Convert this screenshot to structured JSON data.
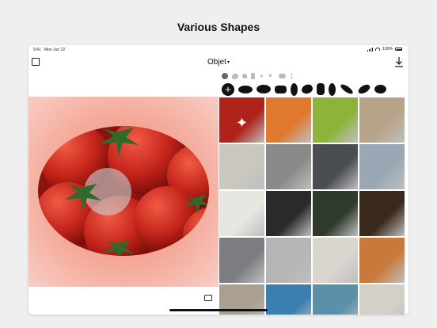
{
  "headline": "Various Shapes",
  "status_bar": {
    "time": "9:41",
    "date": "Mon Jun 22",
    "battery": "100%"
  },
  "toolbar": {
    "title": "Objet",
    "select_icon": "square-outline-icon",
    "download_icon": "download-icon"
  },
  "shape_categories": [
    "circle",
    "blob",
    "drop",
    "rectangle",
    "sparkle",
    "heart",
    "cloud",
    "number-one"
  ],
  "shapes": [
    "add",
    "ellipse-wide",
    "ellipse-wide",
    "rounded-rect",
    "oval-tall",
    "pebble",
    "rounded-square",
    "oval-tall",
    "leaf",
    "ellipse-tilted",
    "lemon"
  ],
  "colors": {
    "accent": "#111111",
    "canvas_glow": "#f08a7b"
  },
  "gallery": [
    {
      "name": "tomatoes",
      "color": "#b0231a"
    },
    {
      "name": "apricots",
      "color": "#e0782d"
    },
    {
      "name": "green-apples",
      "color": "#8cb33a"
    },
    {
      "name": "building",
      "color": "#b8a48a"
    },
    {
      "name": "bed-sheets",
      "color": "#c9c7bf"
    },
    {
      "name": "gray-fabric",
      "color": "#8a8a8a"
    },
    {
      "name": "blueberries-glass",
      "color": "#4a4d52"
    },
    {
      "name": "airplane-window",
      "color": "#9aa7b4"
    },
    {
      "name": "whipped-cream",
      "color": "#e8e6e1"
    },
    {
      "name": "pasta-plate",
      "color": "#2a2a2a"
    },
    {
      "name": "exit-sign",
      "color": "#2f3a2c"
    },
    {
      "name": "croissant",
      "color": "#3b2a1c"
    },
    {
      "name": "concrete-wall",
      "color": "#7b7d80"
    },
    {
      "name": "textured-tile",
      "color": "#b5b5b5"
    },
    {
      "name": "paper-bag",
      "color": "#d9d6d0"
    },
    {
      "name": "sunset-water",
      "color": "#c77a3a"
    },
    {
      "name": "room-interior",
      "color": "#a9a092"
    },
    {
      "name": "pool-tiles",
      "color": "#3b7fb0"
    },
    {
      "name": "pool-water",
      "color": "#5c8fa8"
    },
    {
      "name": "bag",
      "color": "#d3d0c8"
    }
  ]
}
